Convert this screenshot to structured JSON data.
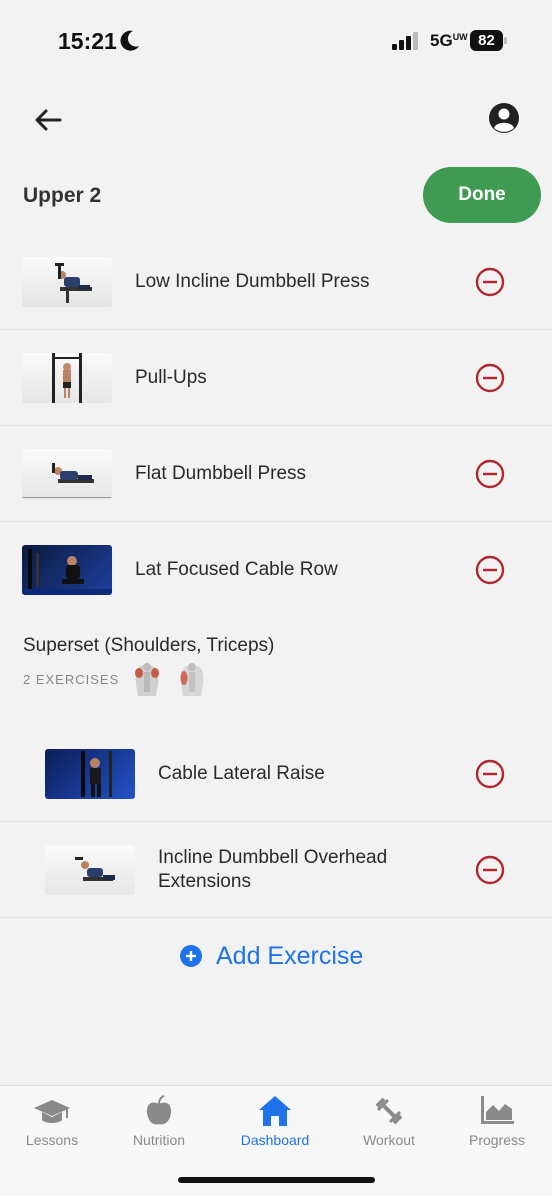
{
  "status_bar": {
    "time": "15:21",
    "network": "5G",
    "network_sup": "UW",
    "battery": "82"
  },
  "workout": {
    "title": "Upper 2",
    "done_label": "Done"
  },
  "exercises": [
    {
      "name": "Low Incline Dumbbell Press"
    },
    {
      "name": "Pull-Ups"
    },
    {
      "name": "Flat Dumbbell Press"
    },
    {
      "name": "Lat Focused Cable Row"
    }
  ],
  "superset": {
    "title": "Superset (Shoulders, Triceps)",
    "count_label": "2 EXERCISES",
    "exercises": [
      {
        "name": "Cable Lateral Raise"
      },
      {
        "name": "Incline Dumbbell Overhead Extensions"
      }
    ]
  },
  "add_exercise_label": "Add Exercise",
  "tabs": [
    {
      "label": "Lessons",
      "icon": "graduation-cap-icon"
    },
    {
      "label": "Nutrition",
      "icon": "apple-icon"
    },
    {
      "label": "Dashboard",
      "icon": "home-icon"
    },
    {
      "label": "Workout",
      "icon": "dumbbell-icon"
    },
    {
      "label": "Progress",
      "icon": "chart-icon"
    }
  ],
  "active_tab": "Dashboard",
  "colors": {
    "accent": "#1e73e8",
    "done_green": "#3f9a52",
    "remove_red": "#b3262d"
  }
}
